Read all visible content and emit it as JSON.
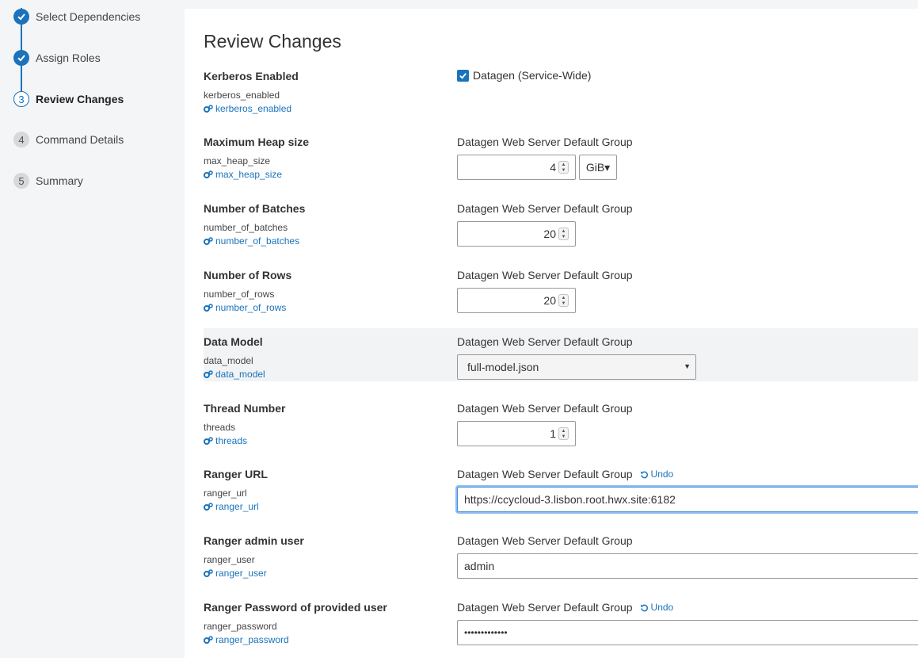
{
  "wizard": {
    "steps": [
      {
        "marker": "✓",
        "label": "Select Dependencies",
        "state": "done"
      },
      {
        "marker": "✓",
        "label": "Assign Roles",
        "state": "done"
      },
      {
        "marker": "3",
        "label": "Review Changes",
        "state": "current"
      },
      {
        "marker": "4",
        "label": "Command Details",
        "state": "todo"
      },
      {
        "marker": "5",
        "label": "Summary",
        "state": "todo"
      }
    ]
  },
  "page": {
    "title": "Review Changes"
  },
  "colors": {
    "accent": "#1a73bb",
    "row_highlight": "#f2f3f4",
    "focus_ring": "#8dbdf0"
  },
  "config": [
    {
      "title": "Kerberos Enabled",
      "key": "kerberos_enabled",
      "link": "kerberos_enabled",
      "checkbox_label": "Datagen (Service-Wide)",
      "checked": true
    },
    {
      "title": "Maximum Heap size",
      "key": "max_heap_size",
      "link": "max_heap_size",
      "group": "Datagen Web Server Default Group",
      "value": "4",
      "unit": "GiB▾"
    },
    {
      "title": "Number of Batches",
      "key": "number_of_batches",
      "link": "number_of_batches",
      "group": "Datagen Web Server Default Group",
      "value": "20"
    },
    {
      "title": "Number of Rows",
      "key": "number_of_rows",
      "link": "number_of_rows",
      "group": "Datagen Web Server Default Group",
      "value": "20"
    },
    {
      "title": "Data Model",
      "key": "data_model",
      "link": "data_model",
      "group": "Datagen Web Server Default Group",
      "value": "full-model.json"
    },
    {
      "title": "Thread Number",
      "key": "threads",
      "link": "threads",
      "group": "Datagen Web Server Default Group",
      "value": "1"
    },
    {
      "title": "Ranger URL",
      "key": "ranger_url",
      "link": "ranger_url",
      "group": "Datagen Web Server Default Group",
      "undo": "Undo",
      "value": "https://ccycloud-3.lisbon.root.hwx.site:6182"
    },
    {
      "title": "Ranger admin user",
      "key": "ranger_user",
      "link": "ranger_user",
      "group": "Datagen Web Server Default Group",
      "value": "admin"
    },
    {
      "title": "Ranger Password of provided user",
      "key": "ranger_password",
      "link": "ranger_password",
      "group": "Datagen Web Server Default Group",
      "undo": "Undo",
      "value": "•••••••••••••"
    }
  ]
}
